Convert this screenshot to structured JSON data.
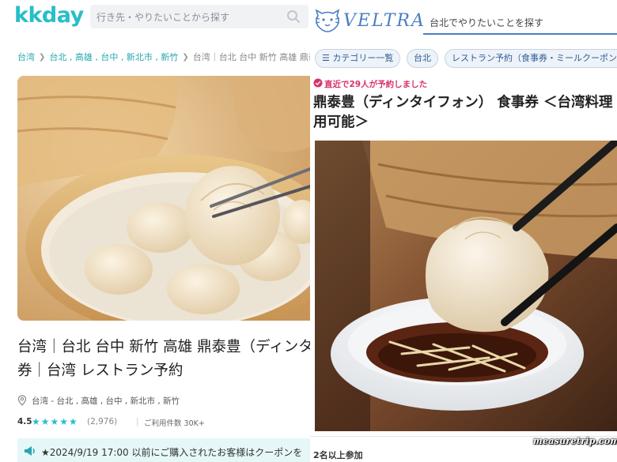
{
  "kkday": {
    "logo": "kkday",
    "search_placeholder": "行き先・やりたいことから探す",
    "breadcrumbs": [
      "台湾",
      "台北 , 高雄 , 台中 , 新北市 , 新竹",
      "台湾｜台北 台中 新竹 高雄 鼎泰"
    ],
    "title_lines": [
      "台湾｜台北 台中 新竹 高雄 鼎泰豊（ディンタ",
      "券｜台湾 レストラン予約"
    ],
    "location": "台湾 - 台北 , 高雄 , 台中 , 新北市 , 新竹",
    "rating": "4.5",
    "stars": "★★★★★",
    "review_count": "(2,976)",
    "usage_label": "ご利用件数 30K+",
    "notice": "★2024/9/19 17:00 以前にご購入されたお客様はクーポンを",
    "accent_color": "#26bec9"
  },
  "veltra": {
    "logo": "VELTRA",
    "search_placeholder": "台北でやりたいことを探す",
    "chips": [
      "カテゴリー一覧",
      "台北",
      "レストラン予約（食事券・ミールクーポン）"
    ],
    "booked_notice": "直近で29人が予約しました",
    "title_lines": [
      "鼎泰豊（ディンタイフォン） 食事券 ＜台湾料理",
      "用可能＞"
    ],
    "min_people": "2名以上参加",
    "accent_color": "#4a7ec2",
    "alert_color": "#d8336b"
  },
  "watermark": "measuretrip.com"
}
